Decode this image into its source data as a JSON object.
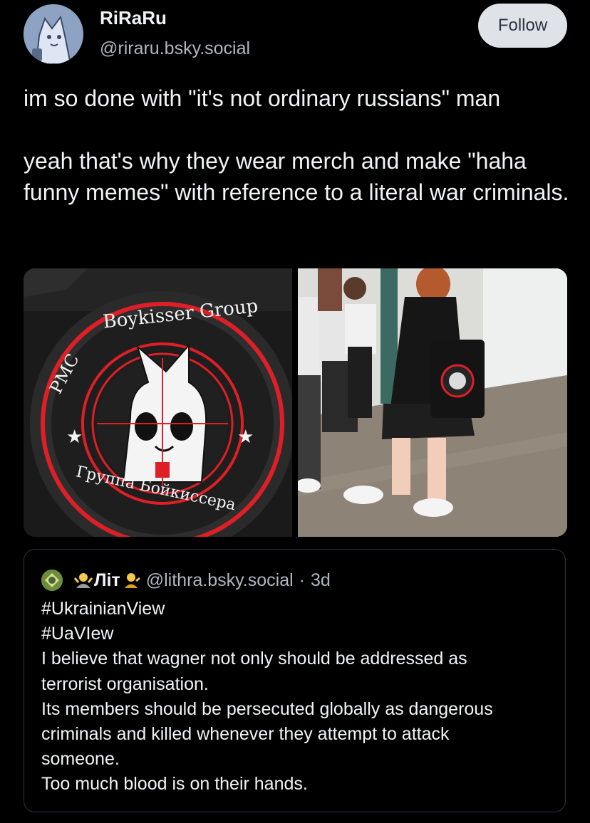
{
  "post": {
    "author": {
      "display_name": "RiRaRu",
      "handle": "@riraru.bsky.social",
      "avatar_icon": "cartoon-cat-avatar"
    },
    "follow_label": "Follow",
    "text": [
      "im so done with \"it's not ordinary russians\" man",
      "yeah that's why they wear merch and make \"haha funny memes\" with reference to a literal war criminals."
    ],
    "images": [
      {
        "name": "pmc-boykisser-patch",
        "patch_top_text": "Boykisser Group",
        "patch_left_text": "PMC",
        "patch_bottom_text": "Группа Бойкиссера"
      },
      {
        "name": "schoolgirls-hallway-photo"
      }
    ]
  },
  "quote": {
    "author_name": "Літ",
    "author_emoji_left": "person-shrugging-emoji",
    "author_emoji_right": "person-tipping-hand-emoji",
    "handle": "@lithra.bsky.social",
    "separator": "·",
    "time": "3d",
    "lines": [
      "#UkrainianView",
      "#UaVIew",
      "I believe that wagner not only should be addressed as",
      "terrorist organisation.",
      "Its members should be persecuted globally as dangerous",
      "criminals and killed whenever they attempt to attack",
      "someone.",
      "Too much blood is on their hands."
    ]
  },
  "colors": {
    "background": "#000000",
    "text": "#f1f3f5",
    "muted_text": "#aeb7c2",
    "follow_bg": "#dfe3e8",
    "follow_text": "#2b3440",
    "card_border": "#2d343d",
    "patch_red": "#e01e26"
  }
}
